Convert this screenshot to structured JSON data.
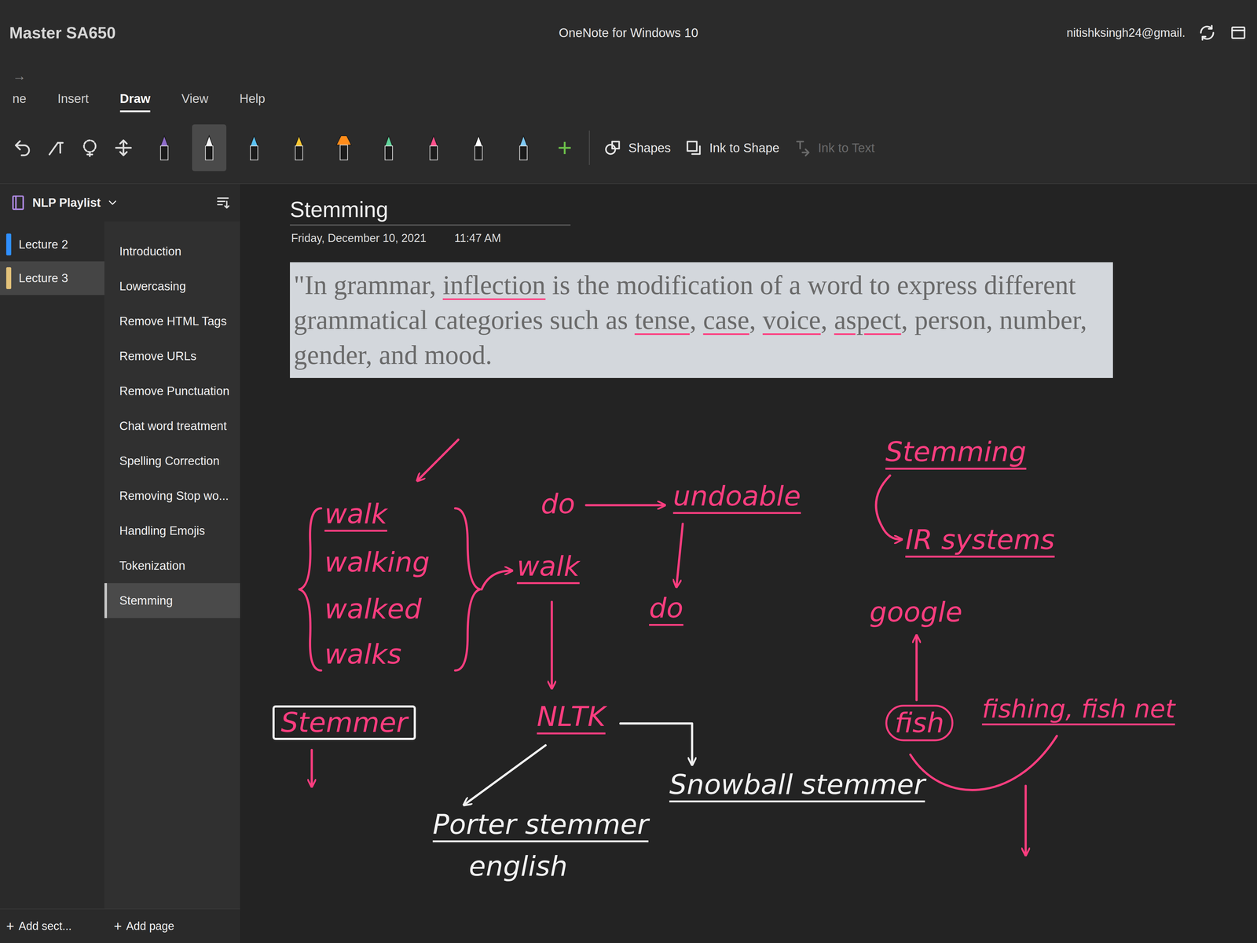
{
  "window": {
    "badge": "Master SA650",
    "title": "OneNote for Windows 10",
    "account": "nitishksingh24@gmail."
  },
  "nav_arrow": "→",
  "ribbon_tabs": [
    {
      "label": "ne",
      "selected": false
    },
    {
      "label": "Insert",
      "selected": false
    },
    {
      "label": "Draw",
      "selected": true
    },
    {
      "label": "View",
      "selected": false
    },
    {
      "label": "Help",
      "selected": false
    }
  ],
  "toolbar": {
    "pens": [
      {
        "kind": "pen",
        "color": "#8e6cc9",
        "selected": false
      },
      {
        "kind": "pen",
        "color": "#f2f2f2",
        "selected": true
      },
      {
        "kind": "pen",
        "color": "#5bc0f0",
        "selected": false
      },
      {
        "kind": "pen",
        "color": "#f4c430",
        "selected": false
      },
      {
        "kind": "highlighter",
        "color": "#ff8c1a",
        "selected": false
      },
      {
        "kind": "pen",
        "color": "#5fd39a",
        "selected": false
      },
      {
        "kind": "pen",
        "color": "#ff4f8b",
        "selected": false
      },
      {
        "kind": "pen",
        "color": "#ffffff",
        "selected": false
      },
      {
        "kind": "pen",
        "color": "#7ec8f2",
        "selected": false
      }
    ],
    "add": "+",
    "buttons": [
      {
        "label": "Shapes",
        "disabled": false
      },
      {
        "label": "Ink to Shape",
        "disabled": false
      },
      {
        "label": "Ink to Text",
        "disabled": true
      }
    ]
  },
  "notebook": {
    "name": "NLP Playlist"
  },
  "sections": [
    {
      "label": "Lecture 2",
      "color": "#2f8fff",
      "selected": false
    },
    {
      "label": "Lecture 3",
      "color": "#e3c27a",
      "selected": true
    }
  ],
  "pages": [
    {
      "label": "Introduction",
      "selected": false
    },
    {
      "label": "Lowercasing",
      "selected": false
    },
    {
      "label": "Remove HTML Tags",
      "selected": false
    },
    {
      "label": "Remove URLs",
      "selected": false
    },
    {
      "label": "Remove Punctuation",
      "selected": false
    },
    {
      "label": "Chat word treatment",
      "selected": false
    },
    {
      "label": "Spelling Correction",
      "selected": false
    },
    {
      "label": "Removing Stop wo...",
      "selected": false
    },
    {
      "label": "Handling Emojis",
      "selected": false
    },
    {
      "label": "Tokenization",
      "selected": false
    },
    {
      "label": "Stemming",
      "selected": true
    }
  ],
  "footer": {
    "plus": "+",
    "add_section": "Add sect...",
    "add_page": "Add page"
  },
  "page": {
    "title": "Stemming",
    "date": "Friday, December 10, 2021",
    "time": "11:47 AM",
    "quote": [
      {
        "text": "\"In grammar, ",
        "underlined": false
      },
      {
        "text": "inflection",
        "underlined": true
      },
      {
        "text": " is the modification of a word to express different grammatical categories such as ",
        "underlined": false
      },
      {
        "text": "tense",
        "underlined": true
      },
      {
        "text": ", ",
        "underlined": false
      },
      {
        "text": "case",
        "underlined": true
      },
      {
        "text": ", ",
        "underlined": false
      },
      {
        "text": "voice",
        "underlined": true
      },
      {
        "text": ", ",
        "underlined": false
      },
      {
        "text": "aspect",
        "underlined": true
      },
      {
        "text": ", person, number, gender, and mood.",
        "underlined": false
      }
    ]
  },
  "ink": [
    {
      "text": "walk",
      "color": "#ff3d7f",
      "kind": "underlined"
    },
    {
      "text": "walking",
      "color": "#ff3d7f",
      "kind": "plain"
    },
    {
      "text": "walked",
      "color": "#ff3d7f",
      "kind": "plain"
    },
    {
      "text": "walks",
      "color": "#ff3d7f",
      "kind": "plain"
    },
    {
      "text": "walk",
      "color": "#ff3d7f",
      "kind": "underlined"
    },
    {
      "text": "do",
      "color": "#ff3d7f",
      "kind": "plain"
    },
    {
      "text": "undoable",
      "color": "#ff3d7f",
      "kind": "underlined"
    },
    {
      "text": "do",
      "color": "#ff3d7f",
      "kind": "underlined"
    },
    {
      "text": "Stemming",
      "color": "#ff3d7f",
      "kind": "underlined"
    },
    {
      "text": "IR systems",
      "color": "#ff3d7f",
      "kind": "underlined"
    },
    {
      "text": "google",
      "color": "#ff3d7f",
      "kind": "plain"
    },
    {
      "text": "fish",
      "color": "#ff3d7f",
      "kind": "circled"
    },
    {
      "text": "fishing, fish net",
      "color": "#ff3d7f",
      "kind": "underlined"
    },
    {
      "text": "Stemmer",
      "color": "#ff3d7f",
      "kind": "boxed"
    },
    {
      "text": "NLTK",
      "color": "#ff3d7f",
      "kind": "underlined"
    },
    {
      "text": "Porter stemmer",
      "color": "#f2f2f2",
      "kind": "underlined"
    },
    {
      "text": "english",
      "color": "#f2f2f2",
      "kind": "plain"
    },
    {
      "text": "Snowball stemmer",
      "color": "#f2f2f2",
      "kind": "underlined"
    }
  ]
}
